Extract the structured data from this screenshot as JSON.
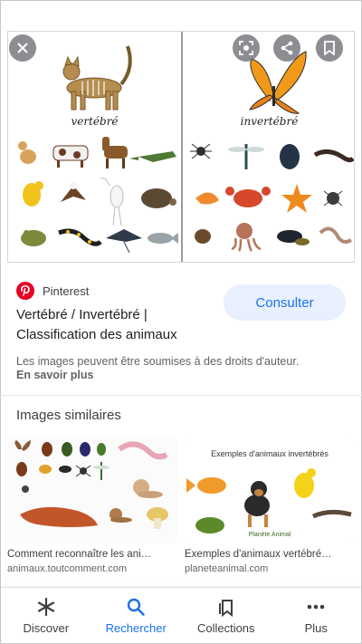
{
  "preview": {
    "left_title": "vertébré",
    "right_title": "invertébré",
    "buttons": {
      "close_icon": "close-icon",
      "lens_icon": "lens-icon",
      "share_icon": "share-icon",
      "bookmark_icon": "bookmark-icon"
    }
  },
  "result": {
    "source": "Pinterest",
    "title": "Vertébré / Invertébré | Classification des animaux",
    "action_label": "Consulter",
    "copyright_notice": "Les images peuvent être soumises à des droits d'auteur.",
    "learn_more": "En savoir plus"
  },
  "similar": {
    "heading": "Images similaires",
    "items": [
      {
        "caption": "Comment reconnaître les ani…",
        "domain": "animaux.toutcomment.com"
      },
      {
        "caption": "Exemples d'animaux vertébré…",
        "domain": "planeteanimal.com",
        "image_title": "Exemples d'animaux invertébrés",
        "image_watermark": "Planète Animal"
      }
    ]
  },
  "nav": {
    "items": [
      {
        "label": "Discover",
        "icon": "asterisk-icon"
      },
      {
        "label": "Rechercher",
        "icon": "search-icon"
      },
      {
        "label": "Collections",
        "icon": "collections-icon"
      },
      {
        "label": "Plus",
        "icon": "more-icon"
      }
    ]
  },
  "colors": {
    "accent": "#1a73e8",
    "consult_bg": "#e8f0fe",
    "pinterest": "#e60023"
  }
}
